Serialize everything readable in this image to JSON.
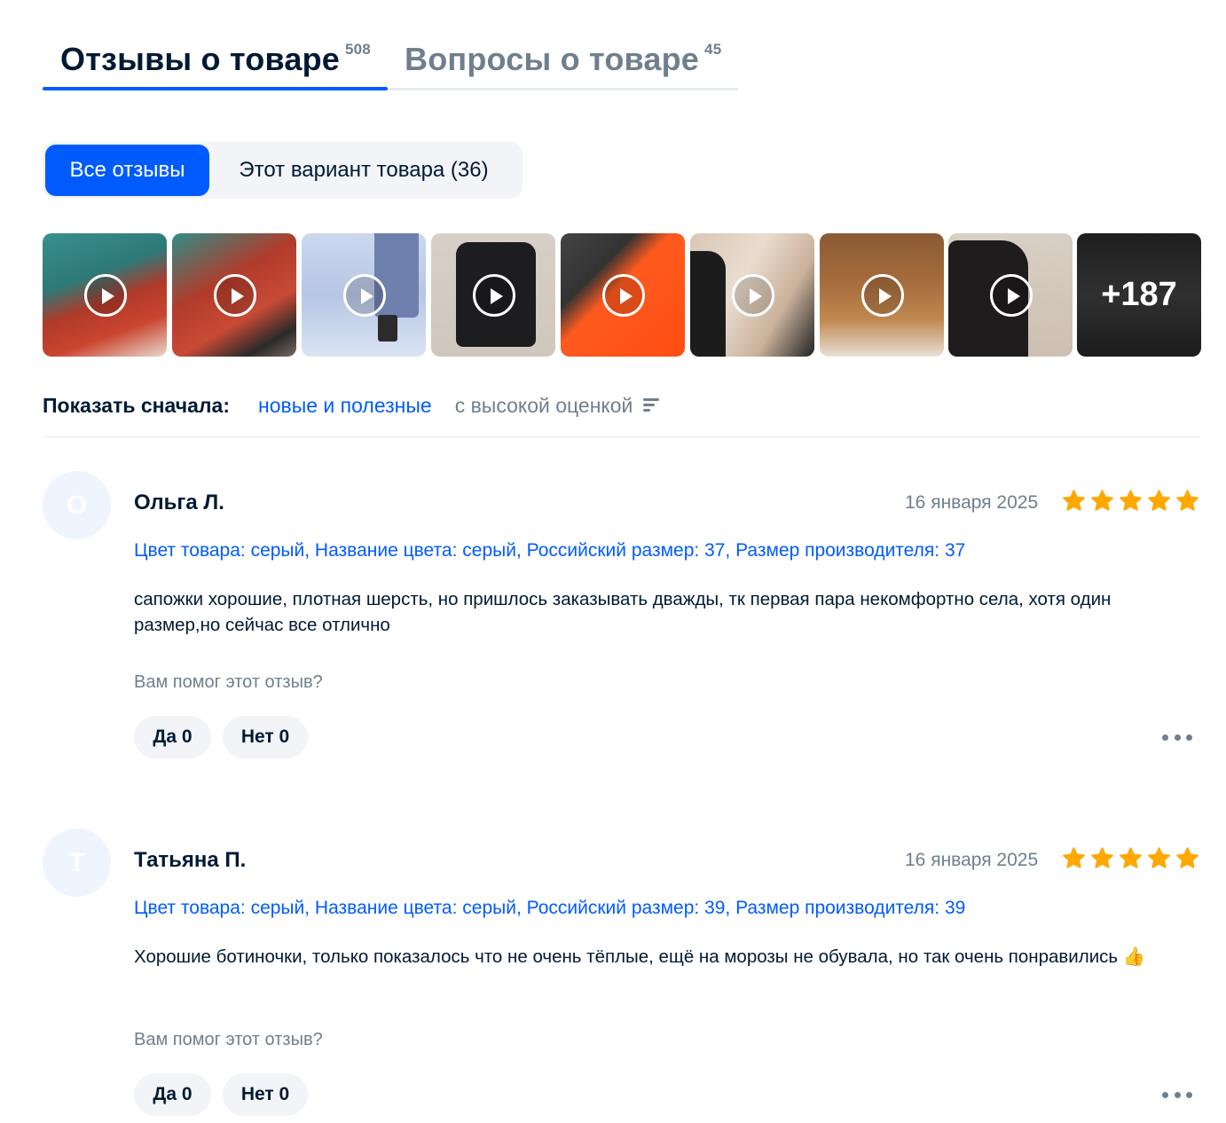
{
  "tabs": {
    "reviews": {
      "label": "Отзывы о товаре",
      "count": "508"
    },
    "questions": {
      "label": "Вопросы о товаре",
      "count": "45"
    }
  },
  "filter": {
    "all_label": "Все отзывы",
    "variant_label": "Этот вариант товара (36)"
  },
  "media": {
    "thumbnails": [
      {
        "type": "video",
        "subject": "red suede ankle boots"
      },
      {
        "type": "video",
        "subject": "red suede boots on feet"
      },
      {
        "type": "video",
        "subject": "boots on snow"
      },
      {
        "type": "video",
        "subject": "black leather lace-up boot"
      },
      {
        "type": "video",
        "subject": "shoe box"
      },
      {
        "type": "video",
        "subject": "boot with label"
      },
      {
        "type": "video",
        "subject": "brown suede boots"
      },
      {
        "type": "video",
        "subject": "black leather boot"
      },
      {
        "type": "more",
        "subject": "more media"
      }
    ],
    "more_label": "+187"
  },
  "sort": {
    "label": "Показать сначала:",
    "option_new": "новые и полезные",
    "option_rating": "с высокой оценкой"
  },
  "reviews": [
    {
      "avatar_letter": "О",
      "author": "Ольга Л.",
      "date": "16 января 2025",
      "rating": 5,
      "variant": "Цвет товара: серый, Название цвета: серый, Российский размер: 37, Размер производителя: 37",
      "text": "сапожки хорошие, плотная шерсть, но пришлось заказывать дважды, тк первая пара некомфортно села, хотя один размер,но сейчас все отлично",
      "helpful_question": "Вам помог этот отзыв?",
      "yes_label": "Да 0",
      "no_label": "Нет 0"
    },
    {
      "avatar_letter": "Т",
      "author": "Татьяна П.",
      "date": "16 января 2025",
      "rating": 5,
      "variant": "Цвет товара: серый, Название цвета: серый, Российский размер: 39, Размер производителя: 39",
      "text": "Хорошие ботиночки, только показалось что не очень тёплые, ещё на морозы не обувала, но так очень понравились 👍",
      "helpful_question": "Вам помог этот отзыв?",
      "yes_label": "Да 0",
      "no_label": "Нет 0"
    }
  ],
  "colors": {
    "accent": "#005bff",
    "star": "#ffa800",
    "text_primary": "#001a34",
    "text_secondary": "#707f8d"
  }
}
